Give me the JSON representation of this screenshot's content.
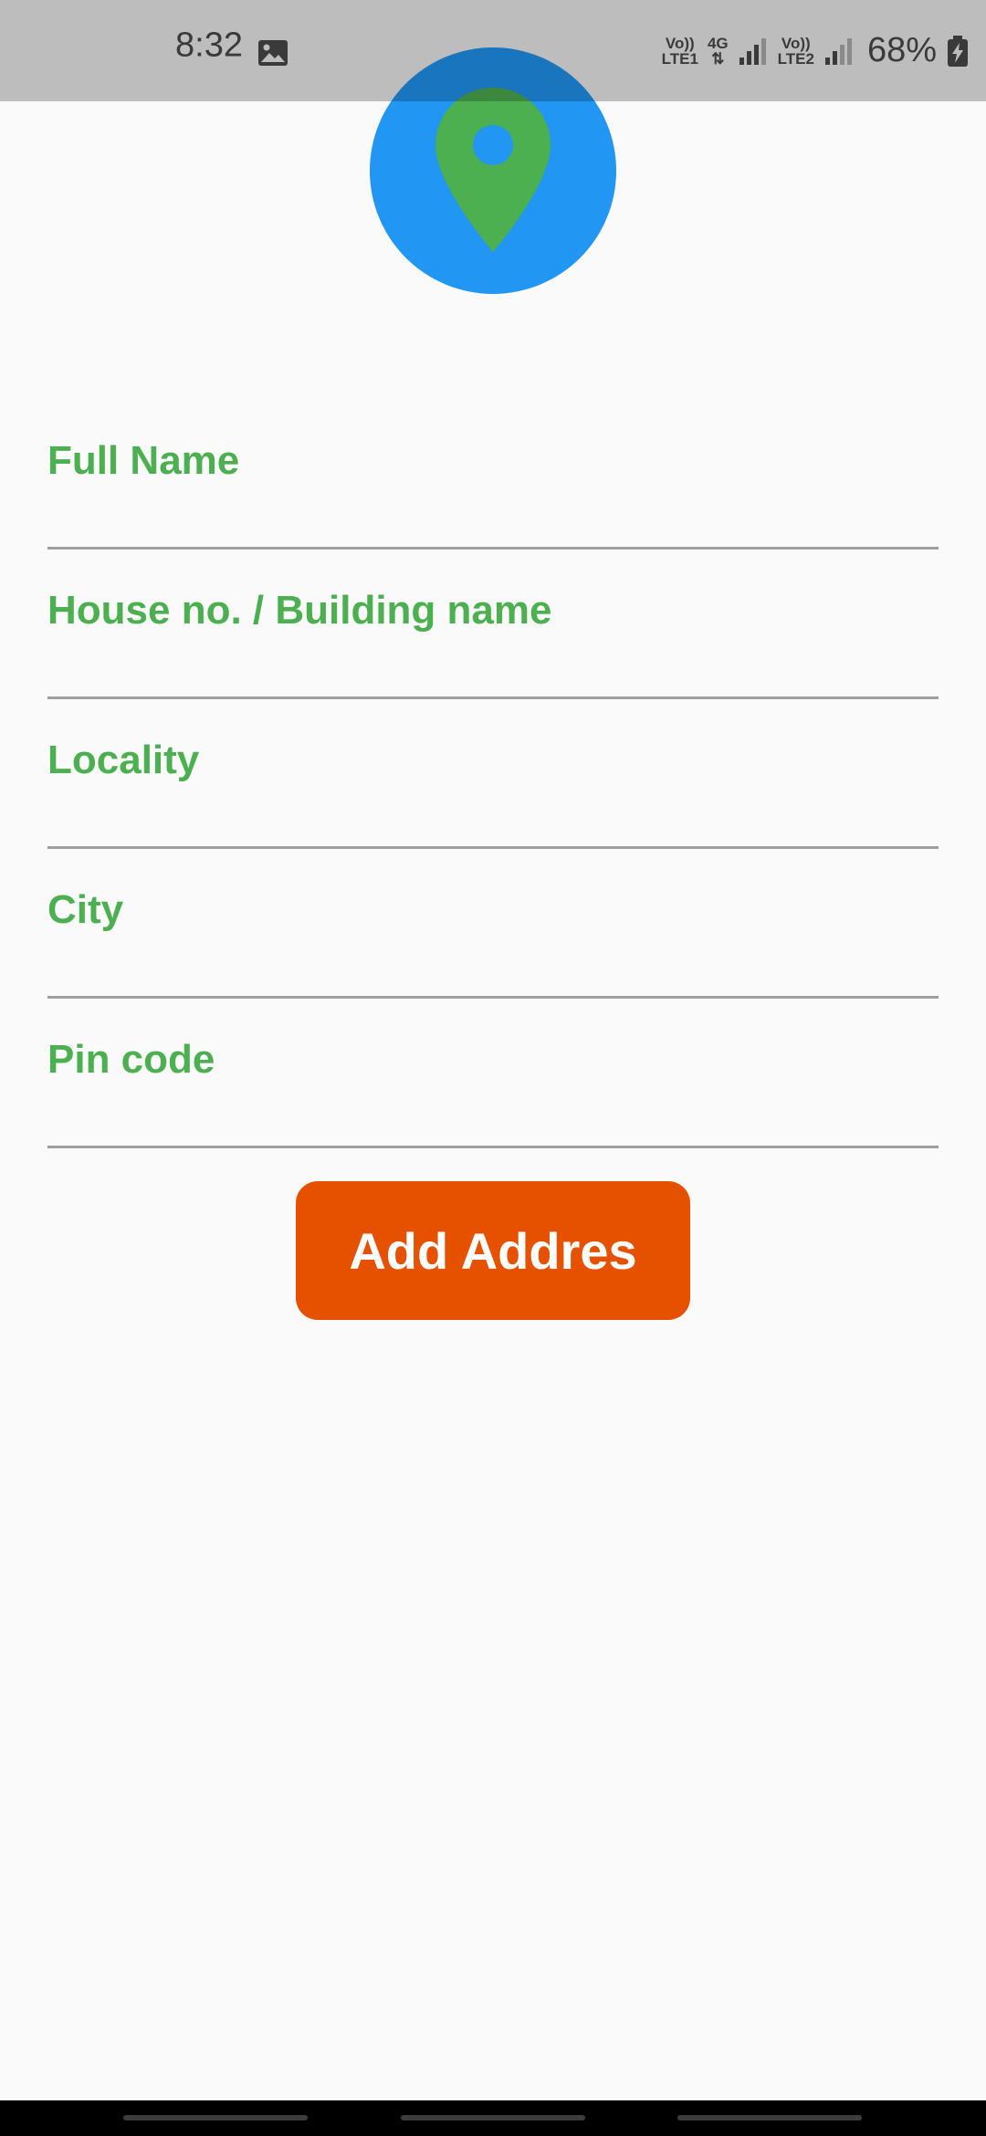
{
  "status_bar": {
    "time": "8:32",
    "net1_top": "Vo))",
    "net1_bottom": "LTE1",
    "net_type": "4G",
    "net2_top": "Vo))",
    "net2_bottom": "LTE2",
    "battery": "68%",
    "icons": [
      "gallery-icon",
      "signal-icon",
      "signal-icon",
      "battery-charging-icon"
    ]
  },
  "header": {
    "icon": "location-pin-icon",
    "colors": {
      "circle": "#2196f3",
      "pin": "#4caf50"
    }
  },
  "form": {
    "fields": [
      {
        "label": "Full Name"
      },
      {
        "label": "House no. / Building name"
      },
      {
        "label": "Locality"
      },
      {
        "label": "City"
      },
      {
        "label": "Pin code"
      }
    ],
    "label_color": "#4caf50",
    "submit_label": "Add Addres",
    "submit_color": "#e65100"
  }
}
